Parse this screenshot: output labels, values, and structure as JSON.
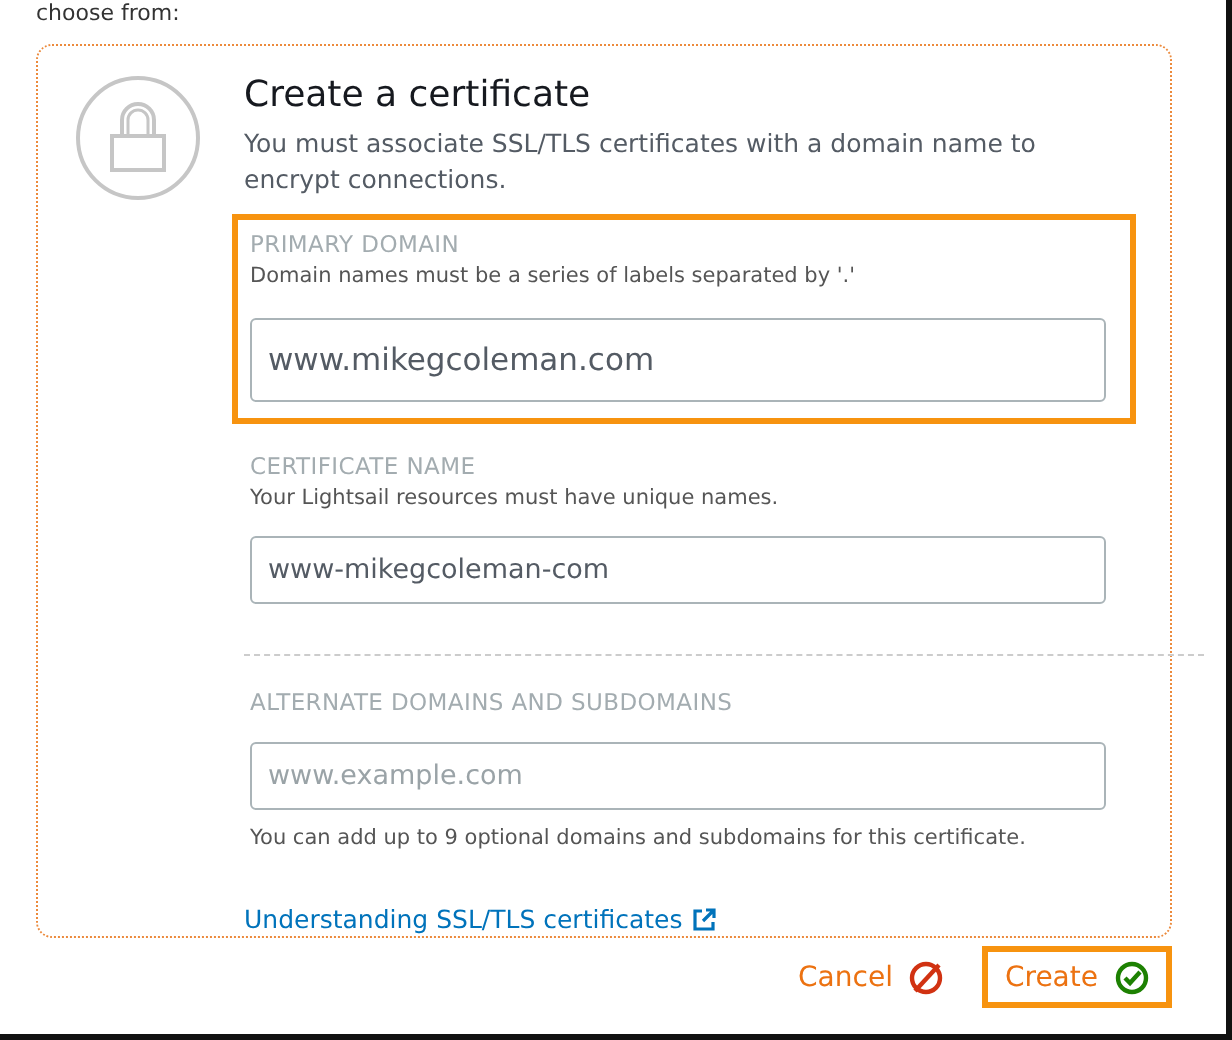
{
  "intro": "choose from:",
  "card": {
    "title": "Create a certificate",
    "description": "You must associate SSL/TLS certificates with a domain name to encrypt connections."
  },
  "fields": [
    {
      "label": "PRIMARY DOMAIN",
      "help": "Domain names must be a series of labels separated by '.'",
      "value": "www.mikegcoleman.com",
      "highlighted": true,
      "divider_before": false
    },
    {
      "label": "CERTIFICATE NAME",
      "help": "Your Lightsail resources must have unique names.",
      "value": "www-mikegcoleman-com",
      "highlighted": false,
      "divider_before": false
    },
    {
      "label": "ALTERNATE DOMAINS AND SUBDOMAINS",
      "placeholder": "www.example.com",
      "note": "You can add up to 9 optional domains and subdomains for this certificate.",
      "highlighted": false,
      "divider_before": true
    }
  ],
  "link": "Understanding SSL/TLS certificates",
  "buttons": [
    {
      "kind": "cancel",
      "label": "Cancel",
      "highlighted": false
    },
    {
      "kind": "create",
      "label": "Create",
      "highlighted": true
    }
  ]
}
